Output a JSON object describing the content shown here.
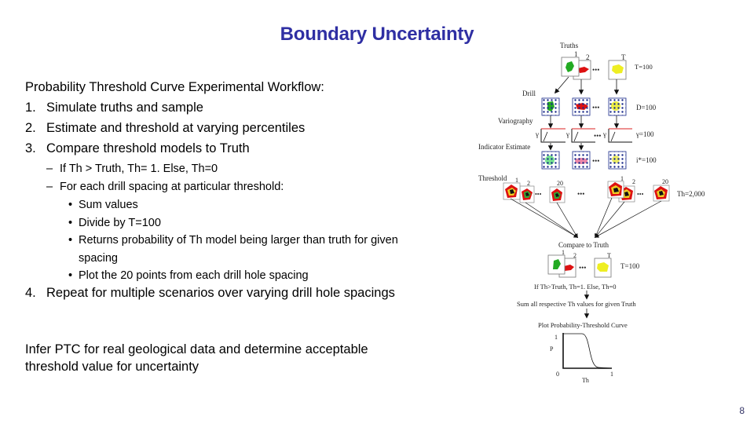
{
  "slide": {
    "title": "Boundary Uncertainty",
    "page_number": "8"
  },
  "content": {
    "heading": "Probability Threshold Curve Experimental Workflow:",
    "steps": [
      {
        "num": "1.",
        "text": "Simulate truths and sample"
      },
      {
        "num": "2.",
        "text": "Estimate and threshold at varying percentiles"
      },
      {
        "num": "3.",
        "text": "Compare threshold models to Truth"
      }
    ],
    "sub_items": [
      {
        "bullet": "–",
        "text": "If Th > Truth, Th= 1.  Else, Th=0"
      },
      {
        "bullet": "–",
        "text": "For each drill spacing at particular threshold:"
      }
    ],
    "sub_sub_items": [
      {
        "bullet": "•",
        "text": "Sum values"
      },
      {
        "bullet": "•",
        "text": "Divide by T=100"
      },
      {
        "bullet": "•",
        "text": "Returns probability of Th model being larger than truth for given spacing"
      },
      {
        "bullet": "•",
        "text": "Plot the 20 points from each drill hole spacing"
      }
    ],
    "step4": {
      "num": "4.",
      "text": "Repeat for multiple scenarios over varying drill hole spacings"
    },
    "conclusion": "Infer PTC for real geological data and determine acceptable threshold value for uncertainty"
  },
  "diagram": {
    "truths_label": "Truths",
    "truth_index_labels": [
      "1",
      "2",
      "T"
    ],
    "truth_count": "T=100",
    "drill_label": "Drill",
    "drill_count": "D=100",
    "variography_label": "Variography",
    "gamma_symbol": "γ",
    "gamma_count": "γ=100",
    "indicator_label": "Indicator Estimate",
    "indicator_count": "i*=100",
    "threshold_label": "Threshold",
    "threshold_index_labels": [
      "1",
      "2",
      "20"
    ],
    "threshold_count": "Th=2,000",
    "ellipsis": "•••",
    "compare_label": "Compare to Truth",
    "compare_index_labels": [
      "1",
      "2",
      "T"
    ],
    "compare_count": "T=100",
    "rule_label": "If Th>Truth, Th=1.  Else, Th=0",
    "sum_label": "Sum all respective Th values for given Truth",
    "plot_label": "Plot Probability-Threshold Curve",
    "plot_y_axis": "P",
    "plot_x_axis": "Th",
    "plot_y_ticks": [
      "1",
      "0"
    ],
    "plot_x_ticks": [
      "1"
    ],
    "colors": {
      "title": "#2f2fa3",
      "truth1": "#22aa22",
      "truth2": "#dd1111",
      "truthT": "#eeee22",
      "grid_dots": "#1a2a8a",
      "threshold_outer": "#dd1111",
      "threshold_mid": "#eecc22",
      "threshold_inner": "#111111"
    }
  }
}
